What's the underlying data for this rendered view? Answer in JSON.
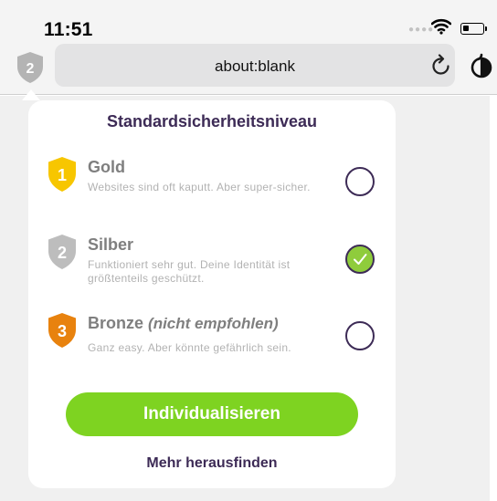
{
  "status_bar": {
    "time": "11:51",
    "signal_icon": "signal-dots",
    "wifi_icon": "wifi-icon",
    "battery_icon": "battery-icon",
    "battery_level": 0.3
  },
  "toolbar": {
    "shield_level": "2",
    "url": "about:blank",
    "reload_icon": "reload-icon",
    "tracker_icon": "tracker-icon"
  },
  "popup": {
    "title": "Standardsicherheitsniveau",
    "options": [
      {
        "level": "1",
        "title": "Gold",
        "note": "",
        "description": "Websites sind oft kaputt. Aber super-sicher.",
        "color": "#f7c600",
        "selected": false
      },
      {
        "level": "2",
        "title": "Silber",
        "note": "",
        "description": "Funktioniert sehr gut. Deine Identität ist größtenteils geschützt.",
        "color": "#bdbdbd",
        "selected": true
      },
      {
        "level": "3",
        "title": "Bronze",
        "note": "(nicht empfohlen)",
        "description": "Ganz easy. Aber könnte gefährlich sein.",
        "color": "#e8820e",
        "selected": false
      }
    ],
    "primary_button": "Individualisieren",
    "secondary_link": "Mehr herausfinden"
  },
  "colors": {
    "accent_green": "#7ed321",
    "check_green": "#8fcc3c",
    "purple_text": "#3d2b56",
    "gold": "#f7c600",
    "silver": "#bdbdbd",
    "bronze": "#e8820e"
  }
}
